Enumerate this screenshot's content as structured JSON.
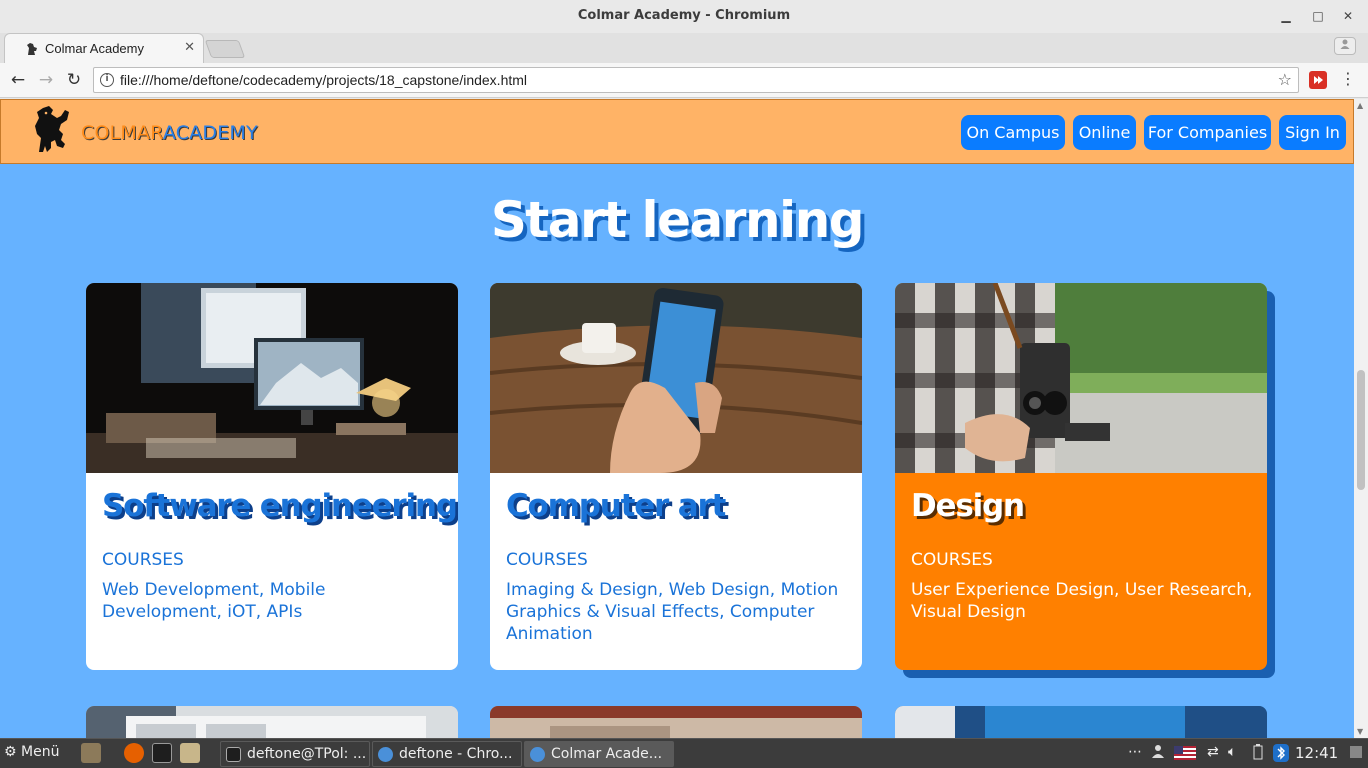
{
  "window": {
    "title": "Colmar Academy - Chromium",
    "min_glyph": "▁",
    "max_glyph": "□",
    "close_glyph": "✕"
  },
  "tabs": [
    {
      "title": "Colmar Academy",
      "close_glyph": "✕"
    }
  ],
  "toolbar": {
    "back_glyph": "←",
    "forward_glyph": "→",
    "reload_glyph": "↻",
    "info_glyph": "i",
    "url": "file:///home/deftone/codecademy/projects/18_capstone/index.html",
    "star_glyph": "☆",
    "menu_glyph": "⋮"
  },
  "site": {
    "logo_part1": "COLMAR",
    "logo_part2": "ACADEMY",
    "nav": [
      "On Campus",
      "Online",
      "For Companies",
      "Sign In"
    ],
    "section_title": "Start learning",
    "cards": [
      {
        "title": "Software engineering",
        "label": "COURSES",
        "text": "Web Development, Mobile Development, iOT, APIs",
        "active": false
      },
      {
        "title": "Computer art",
        "label": "COURSES",
        "text": "Imaging & Design, Web Design, Motion Graphics & Visual Effects, Computer Animation",
        "active": false
      },
      {
        "title": "Design",
        "label": "COURSES",
        "text": "User Experience Design, User Research, Visual Design",
        "active": true
      }
    ]
  },
  "taskbar": {
    "menu_label": "Menü",
    "tasks": [
      "deftone@TPol: ...",
      "deftone - Chro...",
      "Colmar Acade..."
    ],
    "tray_dots": "⋯",
    "clock": "12:41"
  },
  "colors": {
    "page_bg": "#66b2ff",
    "header_bg": "#ffb366",
    "nav_button": "#0a7cff",
    "card_active": "#ff8000",
    "card_title": "#1a73d8"
  }
}
